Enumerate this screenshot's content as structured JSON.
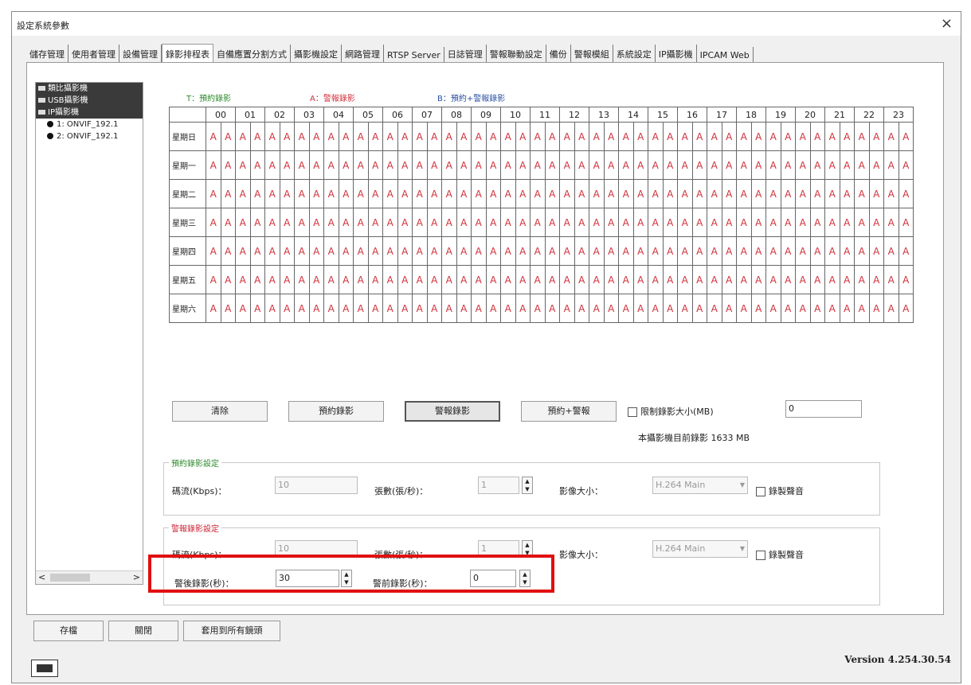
{
  "window": {
    "title": "設定系統參數",
    "close": "×"
  },
  "tabs": [
    "儲存管理",
    "使用者管理",
    "設備管理",
    "錄影排程表",
    "自備應置分割方式",
    "攝影機設定",
    "網路管理",
    "RTSP Server",
    "日誌管理",
    "警報聯動設定",
    "備份",
    "警報模組",
    "系統設定",
    "IP攝影機",
    "IPCAM Web"
  ],
  "active_tab": "錄影排程表",
  "tree": {
    "groups": [
      "類比攝影機",
      "USB攝影機",
      "IP攝影機"
    ],
    "cameras": [
      "1: ONVIF_192.1",
      "2: ONVIF_192.1"
    ]
  },
  "legend": {
    "t": "T：預約錄影",
    "a": "A：警報錄影",
    "b": "B：預約+警報錄影",
    "colors": {
      "t": "#2e8b2e",
      "a": "#d0303a",
      "b": "#2a4fa0"
    }
  },
  "schedule": {
    "hours": [
      "00",
      "01",
      "02",
      "03",
      "04",
      "05",
      "06",
      "07",
      "08",
      "09",
      "10",
      "11",
      "12",
      "13",
      "14",
      "15",
      "16",
      "17",
      "18",
      "19",
      "20",
      "21",
      "22",
      "23"
    ],
    "days": [
      "星期日",
      "星期一",
      "星期二",
      "星期三",
      "星期四",
      "星期五",
      "星期六"
    ],
    "cell_value": "A"
  },
  "actions": {
    "clear": "清除",
    "scheduled": "預約錄影",
    "alarm": "警報錄影",
    "scheduled_alarm": "預約+警報",
    "limit_label": "限制錄影大小(MB)",
    "limit_value": "0",
    "current_usage": "本攝影機目前錄影 1633 MB"
  },
  "scheduled_settings": {
    "title": "預約錄影設定",
    "bitrate_label": "碼流(Kbps)：",
    "bitrate_value": "10",
    "fps_label": "張數(張/秒)：",
    "fps_value": "1",
    "size_label": "影像大小：",
    "size_value": "H.264 Main",
    "audio_label": "錄製聲音"
  },
  "alarm_settings": {
    "title": "警報錄影設定",
    "bitrate_label": "碼流(Kbps)：",
    "bitrate_value": "10",
    "fps_label": "張數(張/秒)：",
    "fps_value": "1",
    "size_label": "影像大小：",
    "size_value": "H.264 Main",
    "audio_label": "錄製聲音",
    "post_label": "警後錄影(秒)：",
    "post_value": "30",
    "pre_label": "警前錄影(秒)：",
    "pre_value": "0"
  },
  "footer": {
    "save": "存檔",
    "close": "關閉",
    "apply_all": "套用到所有鏡頭",
    "version": "Version 4.254.30.54"
  }
}
